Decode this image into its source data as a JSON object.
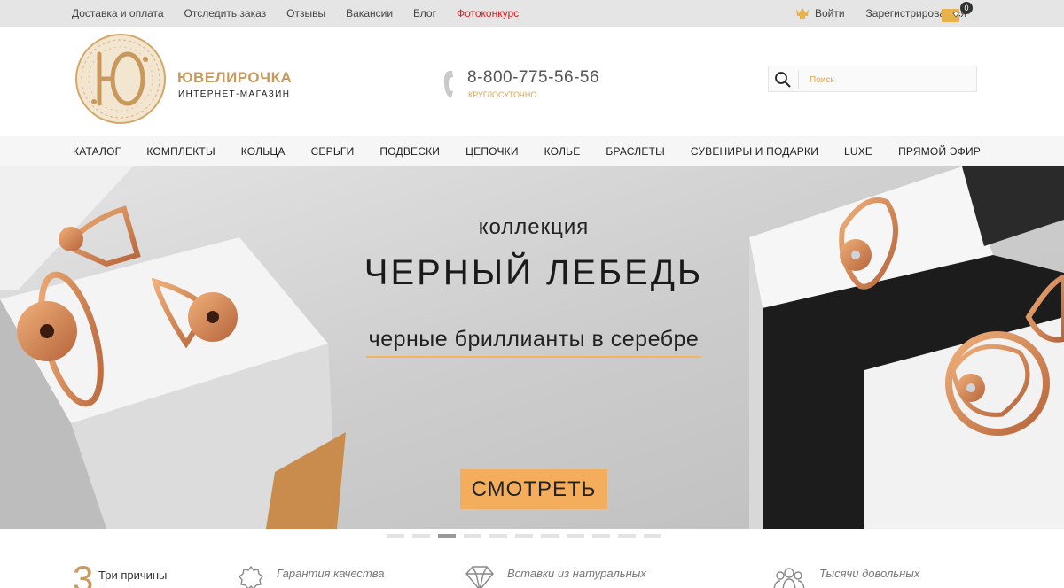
{
  "topbar": {
    "links": [
      "Доставка и оплата",
      "Отследить заказ",
      "Отзывы",
      "Вакансии",
      "Блог",
      "Фотоконкурс"
    ],
    "highlight_color": "#e0191c",
    "login_label": "Войти",
    "register_label": "Зарегистрироваться",
    "cart_count": "0",
    "login_icon": "crown-icon",
    "cart_icon": "cart-icon"
  },
  "header": {
    "brand_name": "ЮВЕЛИРОЧКА",
    "brand_sub": "ИНТЕРНЕТ-МАГАЗИН",
    "phone": "8-800-775-56-56",
    "phone_note": "КРУГЛОСУТОЧНО",
    "search_placeholder": "Поиск",
    "brand_color": "#c89a5e"
  },
  "nav": {
    "items": [
      "КАТАЛОГ",
      "КОМПЛЕКТЫ",
      "КОЛЬЦА",
      "СЕРЬГИ",
      "ПОДВЕСКИ",
      "ЦЕПОЧКИ",
      "КОЛЬЕ",
      "БРАСЛЕТЫ",
      "СУВЕНИРЫ И ПОДАРКИ",
      "LUXE",
      "ПРЯМОЙ ЭФИР"
    ]
  },
  "hero": {
    "kicker": "коллекция",
    "headline": "ЧЕРНЫЙ ЛЕБЕДЬ",
    "tagline": "черные бриллианты в серебре",
    "cta_label": "СМОТРЕТЬ",
    "accent_color": "#f4ad5d"
  },
  "slider": {
    "slide_count": 11,
    "active_index": 2
  },
  "benefits": {
    "number": "3",
    "title": "Три причины",
    "items": [
      "Гарантия качества",
      "Вставки из натуральных",
      "Тысячи довольных"
    ],
    "icons": [
      "badge-icon",
      "diamond-icon",
      "people-icon"
    ]
  }
}
